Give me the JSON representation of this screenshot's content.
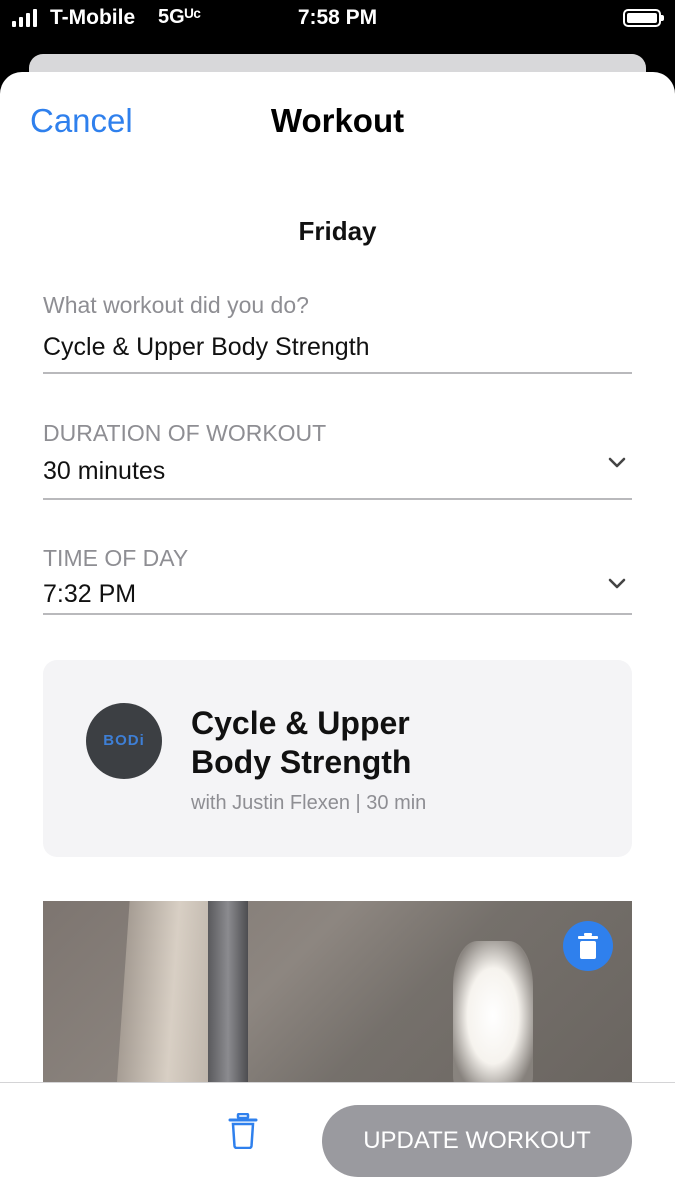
{
  "status_bar": {
    "carrier": "T-Mobile",
    "network": "5Gᵁᶜ",
    "time": "7:58 PM"
  },
  "nav": {
    "cancel_label": "Cancel",
    "title": "Workout"
  },
  "day": "Friday",
  "form": {
    "workout": {
      "label": "What workout did you do?",
      "value": "Cycle & Upper Body Strength"
    },
    "duration": {
      "label": "DURATION OF WORKOUT",
      "value": "30 minutes"
    },
    "time_of_day": {
      "label": "TIME OF DAY",
      "value": "7:32 PM"
    }
  },
  "workout_card": {
    "logo_text": "BODi",
    "title": "Cycle & Upper Body Strength",
    "subtitle": "with Justin Flexen | 30 min"
  },
  "footer": {
    "update_label": "UPDATE WORKOUT"
  },
  "colors": {
    "accent": "#2f80ed",
    "button_disabled": "#9a9a9f"
  }
}
